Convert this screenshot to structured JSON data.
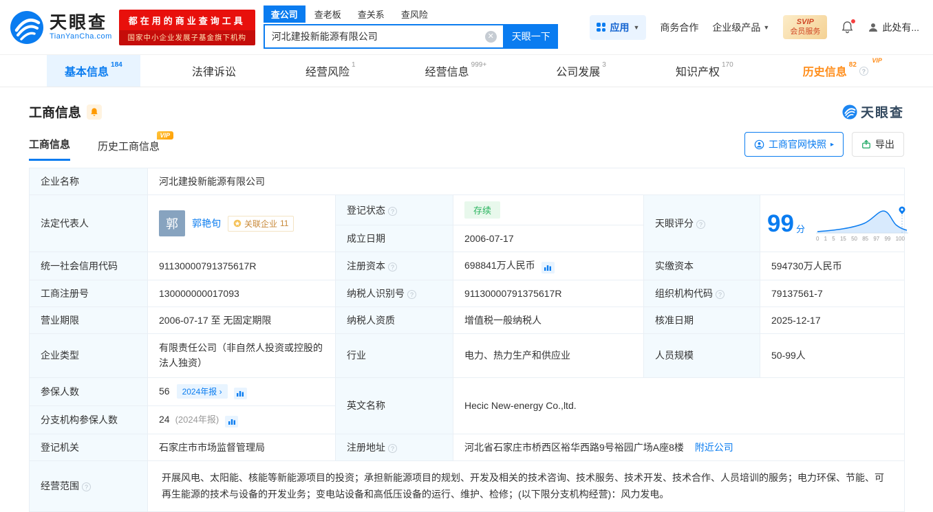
{
  "header": {
    "logo_cn": "天眼查",
    "logo_en": "TianYanCha.com",
    "slogan1": "都在用的商业查询工具",
    "slogan2": "国家中小企业发展子基金旗下机构",
    "search_tabs": [
      {
        "label": "查公司"
      },
      {
        "label": "查老板"
      },
      {
        "label": "查关系"
      },
      {
        "label": "查风险"
      }
    ],
    "search_value": "河北建投新能源有限公司",
    "search_button": "天眼一下",
    "apps_label": "应用",
    "biz_coop": "商务合作",
    "enterprise_product": "企业级产品",
    "svip_line1": "SVIP",
    "svip_line2": "会员服务",
    "user_label": "此处有..."
  },
  "nav": {
    "vip": "VIP",
    "tabs": [
      {
        "label": "基本信息",
        "count": "184"
      },
      {
        "label": "法律诉讼",
        "count": ""
      },
      {
        "label": "经营风险",
        "count": "1"
      },
      {
        "label": "经营信息",
        "count": "999+"
      },
      {
        "label": "公司发展",
        "count": "3"
      },
      {
        "label": "知识产权",
        "count": "170"
      },
      {
        "label": "历史信息",
        "count": "82"
      }
    ]
  },
  "section": {
    "title": "工商信息",
    "watermark": "天眼查",
    "tab_current": "工商信息",
    "tab_history": "历史工商信息",
    "vip_badge": "VIP",
    "snapshot_button": "工商官网快照",
    "export_button": "导出"
  },
  "info": {
    "company_name_label": "企业名称",
    "company_name": "河北建投新能源有限公司",
    "legal_rep_label": "法定代表人",
    "legal_rep_avatar": "郭",
    "legal_rep_name": "郭艳旬",
    "related_companies_label": "关联企业",
    "related_companies_count": "11",
    "reg_status_label": "登记状态",
    "reg_status": "存续",
    "establish_date_label": "成立日期",
    "establish_date": "2006-07-17",
    "score_label": "天眼评分",
    "score_value": "99",
    "score_unit": "分",
    "score_axis": "0 1 5 15 50 85 97 99 100",
    "credit_code_label": "统一社会信用代码",
    "credit_code": "91130000791375617R",
    "reg_capital_label": "注册资本",
    "reg_capital": "698841万人民币",
    "paid_capital_label": "实缴资本",
    "paid_capital": "594730万人民币",
    "reg_number_label": "工商注册号",
    "reg_number": "130000000017093",
    "taxpayer_id_label": "纳税人识别号",
    "taxpayer_id": "91130000791375617R",
    "org_code_label": "组织机构代码",
    "org_code": "79137561-7",
    "business_term_label": "营业期限",
    "business_term": "2006-07-17 至 无固定期限",
    "taxpayer_quality_label": "纳税人资质",
    "taxpayer_quality": "增值税一般纳税人",
    "approval_date_label": "核准日期",
    "approval_date": "2025-12-17",
    "company_type_label": "企业类型",
    "company_type": "有限责任公司（非自然人投资或控股的法人独资）",
    "industry_label": "行业",
    "industry": "电力、热力生产和供应业",
    "staff_size_label": "人员规模",
    "staff_size": "50-99人",
    "insured_label": "参保人数",
    "insured_count": "56",
    "insured_report": "2024年报",
    "english_name_label": "英文名称",
    "english_name": "Hecic New-energy Co.,ltd.",
    "branch_insured_label": "分支机构参保人数",
    "branch_insured_count": "24",
    "branch_insured_report": "(2024年报)",
    "reg_authority_label": "登记机关",
    "reg_authority": "石家庄市市场监督管理局",
    "reg_address_label": "注册地址",
    "reg_address": "河北省石家庄市桥西区裕华西路9号裕园广场A座8楼",
    "nearby_link": "附近公司",
    "business_scope_label": "经营范围",
    "business_scope": "开展风电、太阳能、核能等新能源项目的投资；承担新能源项目的规划、开发及相关的技术咨询、技术服务、技术开发、技术合作、人员培训的服务；电力环保、节能、可再生能源的技术与设备的开发业务；变电站设备和高低压设备的运行、维护、检修；(以下限分支机构经营)：风力发电。"
  }
}
